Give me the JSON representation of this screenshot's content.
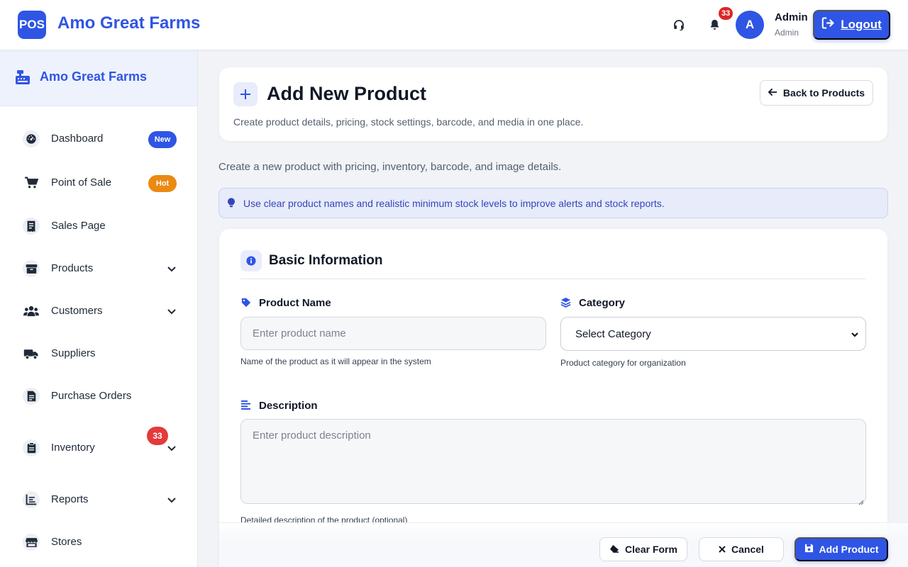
{
  "header": {
    "logo_text": "POS",
    "brand": "Amo Great Farms",
    "notifications_count": "33",
    "avatar_initial": "A",
    "user_name": "Admin",
    "user_role": "Admin",
    "logout_label": "Logout"
  },
  "sidebar": {
    "title": "Amo Great Farms",
    "items": [
      {
        "label": "Dashboard",
        "icon": "gauge-icon",
        "badge": "New"
      },
      {
        "label": "Point of Sale",
        "icon": "cart-icon",
        "badge": "Hot"
      },
      {
        "label": "Sales Page",
        "icon": "receipt-icon"
      },
      {
        "label": "Products",
        "icon": "box-icon"
      },
      {
        "label": "Customers",
        "icon": "users-icon"
      },
      {
        "label": "Suppliers",
        "icon": "truck-icon"
      },
      {
        "label": "Purchase Orders",
        "icon": "file-invoice-icon"
      },
      {
        "label": "Inventory",
        "icon": "clipboard-icon",
        "badge": "33"
      },
      {
        "label": "Reports",
        "icon": "chart-icon"
      },
      {
        "label": "Stores",
        "icon": "store-icon"
      }
    ]
  },
  "page": {
    "title": "Add New Product",
    "subtitle": "Create product details, pricing, stock settings, barcode, and media in one place.",
    "back_label": "Back to Products",
    "intro": "Create a new product with pricing, inventory, barcode, and image details.",
    "tip": "Use clear product names and realistic minimum stock levels to improve alerts and stock reports."
  },
  "form": {
    "section_title": "Basic Information",
    "product_name": {
      "label": "Product Name",
      "placeholder": "Enter product name",
      "help": "Name of the product as it will appear in the system"
    },
    "category": {
      "label": "Category",
      "value": "Select Category",
      "help": "Product category for organization"
    },
    "description": {
      "label": "Description",
      "placeholder": "Enter product description",
      "help": "Detailed description of the product (optional)"
    }
  },
  "actions": {
    "clear_label": "Clear Form",
    "cancel_label": "Cancel",
    "add_label": "Add Product"
  },
  "colors": {
    "primary": "#2f55e4",
    "danger": "#dc2626",
    "warning": "#ea8a13"
  }
}
